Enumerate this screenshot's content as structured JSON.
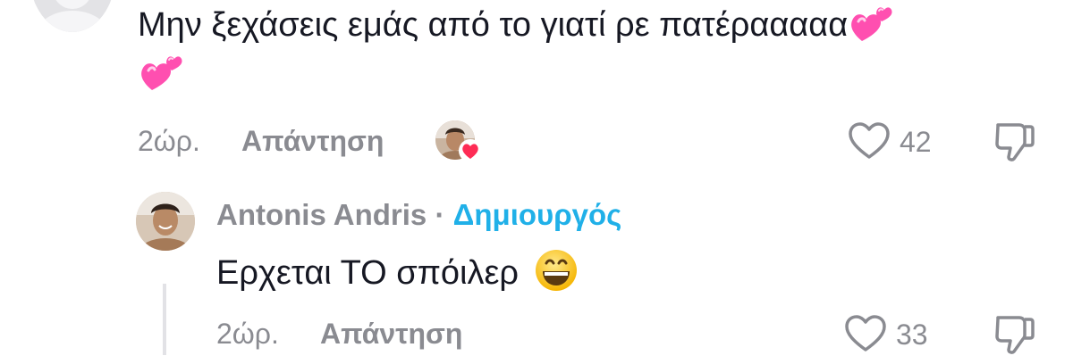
{
  "comment": {
    "text_line1": "Μην ξεχάσεις εμάς από το γιατί ρε πατέρααααα",
    "time": "2ώρ.",
    "reply_label": "Απάντηση",
    "likes": "42",
    "emoji": "two-hearts-emoji"
  },
  "reply": {
    "author": "Antonis Andris",
    "separator": "·",
    "badge": "Δημιουργός",
    "text": "Ερχεται ΤΟ σπόιλερ",
    "time": "2ώρ.",
    "reply_label": "Απάντηση",
    "likes": "33",
    "emoji": "grinning-face-emoji"
  },
  "colors": {
    "text": "#161823",
    "muted": "#8a8b91",
    "creator": "#20b0e8",
    "heart_badge": "#fe2c55",
    "emoji_pink": "#ff4fb0"
  }
}
